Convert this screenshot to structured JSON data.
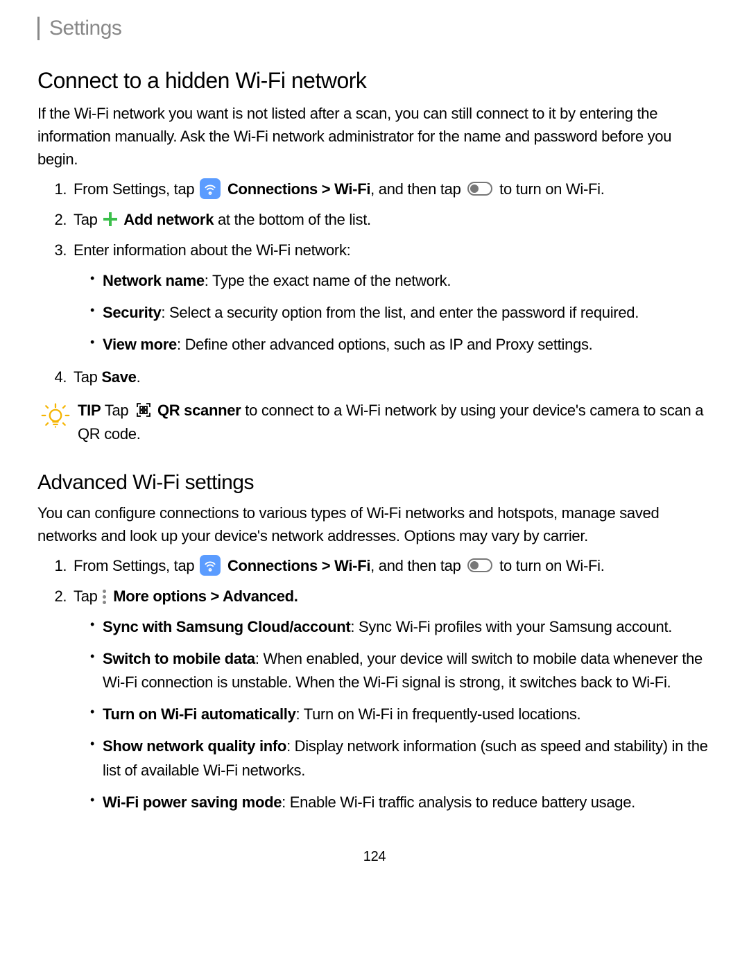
{
  "header": {
    "title": "Settings"
  },
  "section1": {
    "heading": "Connect to a hidden Wi-Fi network",
    "intro": "If the Wi-Fi network you want is not listed after a scan, you can still connect to it by entering the information manually. Ask the Wi-Fi network administrator for the name and password before you begin.",
    "step1_pre": "From Settings, tap ",
    "step1_connections": "Connections",
    "step1_gt": " > ",
    "step1_wifi": "Wi-Fi",
    "step1_mid": ", and then tap ",
    "step1_post": " to turn on Wi-Fi.",
    "step2_pre": "Tap ",
    "step2_add": "Add network",
    "step2_post": " at the bottom of the list.",
    "step3": "Enter information about the Wi-Fi network:",
    "bullets": {
      "b1_label": "Network name",
      "b1_text": ": Type the exact name of the network.",
      "b2_label": "Security",
      "b2_text": ": Select a security option from the list, and enter the password if required.",
      "b3_label": "View more",
      "b3_text": ": Define other advanced options, such as IP and Proxy settings."
    },
    "step4_pre": "Tap ",
    "step4_save": "Save",
    "step4_post": ".",
    "tip_label": "TIP",
    "tip_pre": "  Tap ",
    "tip_qr": "QR scanner",
    "tip_post": " to connect to a Wi-Fi network by using your device's camera to scan a QR code."
  },
  "section2": {
    "heading": "Advanced Wi-Fi settings",
    "intro": "You can configure connections to various types of Wi-Fi networks and hotspots, manage saved networks and look up your device's network addresses. Options may vary by carrier.",
    "step1_pre": "From Settings, tap ",
    "step1_connections": "Connections",
    "step1_gt": " > ",
    "step1_wifi": "Wi-Fi",
    "step1_mid": ", and then tap ",
    "step1_post": " to turn on Wi-Fi.",
    "step2_pre": "Tap ",
    "step2_more": "More options > Advanced.",
    "bullets": {
      "b1_label": "Sync with Samsung Cloud/account",
      "b1_text": ": Sync Wi-Fi profiles with your Samsung account.",
      "b2_label": "Switch to mobile data",
      "b2_text": ": When enabled, your device will switch to mobile data whenever the Wi-Fi connection is unstable. When the Wi-Fi signal is strong, it switches back to Wi-Fi.",
      "b3_label": "Turn on Wi-Fi automatically",
      "b3_text": ": Turn on Wi-Fi in frequently-used locations.",
      "b4_label": "Show network quality info",
      "b4_text": ": Display network information (such as speed and stability) in the list of available Wi-Fi networks.",
      "b5_label": "Wi-Fi power saving mode",
      "b5_text": ": Enable Wi-Fi traffic analysis to reduce battery usage."
    }
  },
  "page_number": "124"
}
